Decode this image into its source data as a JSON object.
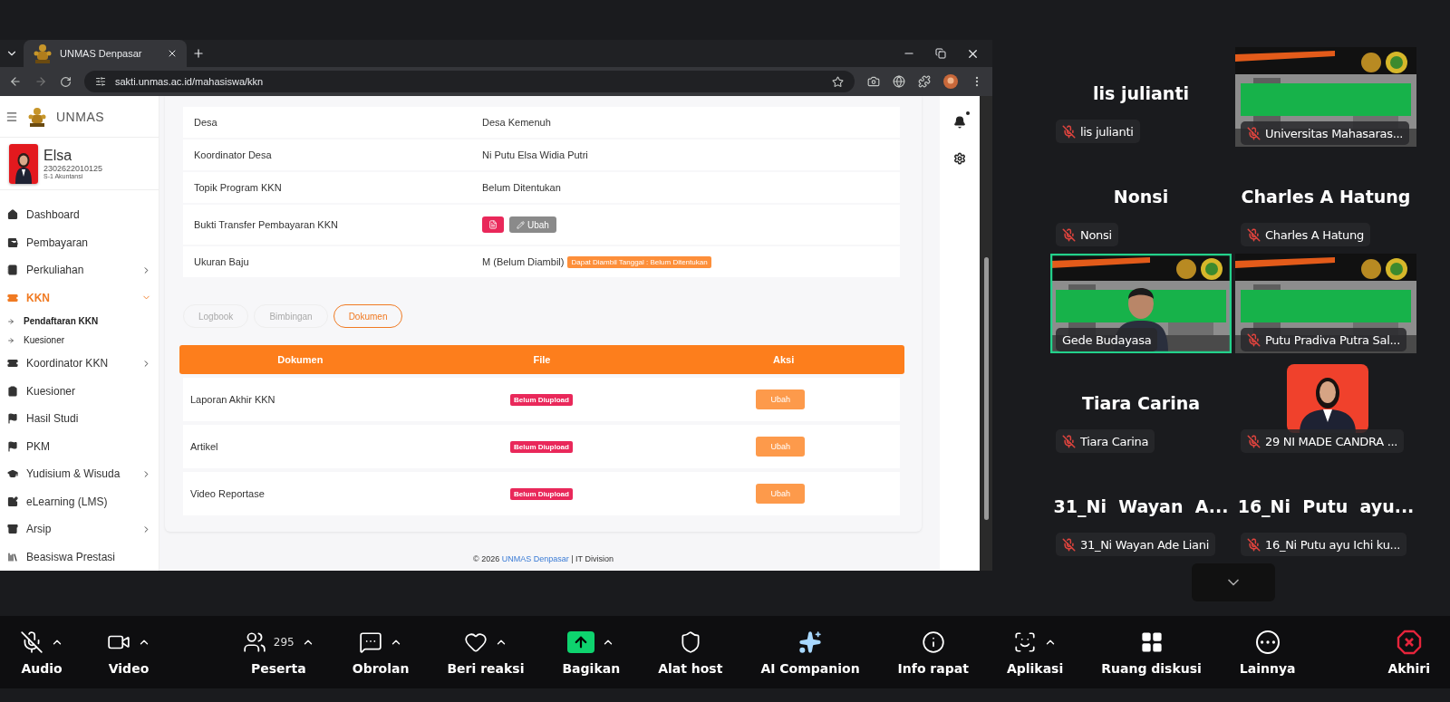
{
  "browser": {
    "tabs": [
      {
        "title": "UNMAS Denpasar",
        "selected": true
      }
    ],
    "url": "sakti.unmas.ac.id/mahasiswa/kkn"
  },
  "sidebar": {
    "brand": "UNMAS",
    "user": {
      "name": "Elsa",
      "id": "2302622010125",
      "program": "S-1 Akuntansi"
    },
    "items": [
      {
        "label": "Dashboard",
        "has_submenu": false,
        "expanded": false,
        "selected": false
      },
      {
        "label": "Pembayaran",
        "has_submenu": false,
        "expanded": false,
        "selected": false
      },
      {
        "label": "Perkuliahan",
        "has_submenu": true,
        "expanded": false,
        "selected": false
      },
      {
        "label": "KKN",
        "has_submenu": true,
        "expanded": true,
        "selected": true,
        "children": [
          {
            "label": "Pendaftaran KKN",
            "selected": true
          },
          {
            "label": "Kuesioner",
            "selected": false
          }
        ]
      },
      {
        "label": "Koordinator KKN",
        "has_submenu": true,
        "expanded": false,
        "selected": false
      },
      {
        "label": "Kuesioner",
        "has_submenu": false,
        "expanded": false,
        "selected": false
      },
      {
        "label": "Hasil Studi",
        "has_submenu": false,
        "expanded": false,
        "selected": false
      },
      {
        "label": "PKM",
        "has_submenu": false,
        "expanded": false,
        "selected": false
      },
      {
        "label": "Yudisium & Wisuda",
        "has_submenu": true,
        "expanded": false,
        "selected": false
      },
      {
        "label": "eLearning (LMS)",
        "has_submenu": false,
        "expanded": false,
        "selected": false
      },
      {
        "label": "Arsip",
        "has_submenu": true,
        "expanded": false,
        "selected": false
      },
      {
        "label": "Beasiswa Prestasi",
        "has_submenu": false,
        "expanded": false,
        "selected": false
      }
    ]
  },
  "info_rows": [
    {
      "kind": "text",
      "label": "Desa",
      "value": "Desa Kemenuh"
    },
    {
      "kind": "text",
      "label": "Koordinator Desa",
      "value": "Ni Putu Elsa Widia Putri"
    },
    {
      "kind": "text",
      "label": "Topik Program KKN",
      "value": "Belum Ditentukan"
    },
    {
      "kind": "actions",
      "label": "Bukti Transfer Pembayaran KKN",
      "edit_label": "Ubah"
    },
    {
      "kind": "badge",
      "label": "Ukuran Baju",
      "value": "M (Belum Diambil)",
      "badge": "Dapat Diambil Tanggal : Belum Ditentukan"
    }
  ],
  "pill_tabs": [
    {
      "label": "Logbook",
      "selected": false
    },
    {
      "label": "Bimbingan",
      "selected": false
    },
    {
      "label": "Dokumen",
      "selected": true
    }
  ],
  "table": {
    "columns": [
      "Dokumen",
      "File",
      "Aksi"
    ],
    "rows": [
      {
        "document": "Laporan Akhir KKN",
        "status": "Belum Diupload",
        "action": "Ubah"
      },
      {
        "document": "Artikel",
        "status": "Belum Diupload",
        "action": "Ubah"
      },
      {
        "document": "Video Reportase",
        "status": "Belum Diupload",
        "action": "Ubah"
      }
    ]
  },
  "footer": {
    "prefix": "© 2026",
    "link": "UNMAS Denpasar",
    "suffix": "| IT Division"
  },
  "participants": [
    {
      "kind": "name",
      "title": "lis julianti",
      "label": "lis julianti",
      "muted": true,
      "speaking": false
    },
    {
      "kind": "video",
      "label": "Universitas Mahasaras...",
      "muted": true,
      "speaking": false
    },
    {
      "kind": "name",
      "title": "Nonsi",
      "label": "Nonsi",
      "muted": true,
      "speaking": false
    },
    {
      "kind": "name",
      "title": "Charles A Hatung",
      "label": "Charles A Hatung",
      "muted": true,
      "speaking": false
    },
    {
      "kind": "presenter",
      "label": "Gede Budayasa",
      "muted": false,
      "speaking": true
    },
    {
      "kind": "video",
      "label": "Putu Pradiva Putra Sal...",
      "muted": true,
      "speaking": false
    },
    {
      "kind": "name",
      "title": "Tiara Carina",
      "label": "Tiara Carina",
      "muted": true,
      "speaking": false
    },
    {
      "label": "29 NI MADE CANDRA ...",
      "muted": true,
      "speaking": false
    },
    {
      "kind": "name",
      "title": "31_Ni  Wayan  A...",
      "label": "31_Ni Wayan Ade Liani",
      "muted": true,
      "speaking": false
    },
    {
      "kind": "name",
      "title": "16_Ni  Putu  ayu...",
      "label": "16_Ni Putu ayu Ichi ku...",
      "muted": true,
      "speaking": false
    }
  ],
  "toolbar": [
    {
      "kind": "audio",
      "label": "Audio",
      "muted": true,
      "caret": true
    },
    {
      "kind": "video",
      "label": "Video",
      "caret": true
    },
    {
      "kind": "participants",
      "label": "Peserta",
      "count": "295",
      "caret": true
    },
    {
      "kind": "chat",
      "label": "Obrolan",
      "caret": true
    },
    {
      "kind": "react",
      "label": "Beri reaksi",
      "caret": true
    },
    {
      "kind": "share",
      "label": "Bagikan",
      "caret": true
    },
    {
      "kind": "host",
      "label": "Alat host",
      "caret": false
    },
    {
      "kind": "ai",
      "label": "AI Companion",
      "caret": false
    },
    {
      "kind": "info",
      "label": "Info rapat",
      "caret": false
    },
    {
      "kind": "apps",
      "label": "Aplikasi",
      "caret": true
    },
    {
      "kind": "rooms",
      "label": "Ruang diskusi",
      "caret": false
    },
    {
      "kind": "more",
      "label": "Lainnya",
      "caret": false
    },
    {
      "kind": "end",
      "label": "Akhiri",
      "caret": false
    }
  ]
}
